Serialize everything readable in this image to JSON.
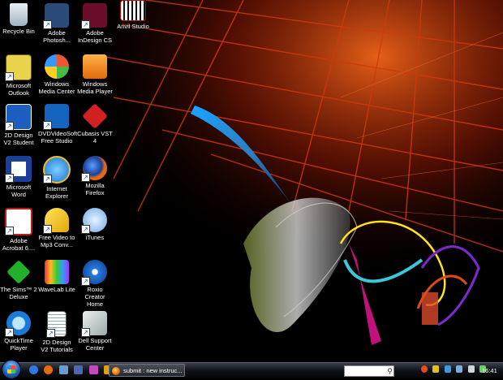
{
  "desktop": {
    "icons": [
      {
        "label": "Recycle Bin",
        "icon": "recycle-bin-icon"
      },
      {
        "label": "Adobe Photosh...",
        "icon": "photoshop-icon"
      },
      {
        "label": "Adobe InDesign CS",
        "icon": "indesign-icon"
      },
      {
        "label": "Anvil Studio",
        "icon": "anvil-studio-icon"
      },
      {
        "label": "Microsoft Outlook",
        "icon": "outlook-icon"
      },
      {
        "label": "Windows Media Center",
        "icon": "media-center-icon"
      },
      {
        "label": "Windows Media Player",
        "icon": "media-player-icon"
      },
      {
        "label": "2D Design V2 Student",
        "icon": "2d-design-icon"
      },
      {
        "label": "DVDVideoSoft Free Studio",
        "icon": "free-studio-icon"
      },
      {
        "label": "Cubasis VST 4",
        "icon": "cubasis-icon"
      },
      {
        "label": "Microsoft Word",
        "icon": "word-icon"
      },
      {
        "label": "Internet Explorer",
        "icon": "internet-explorer-icon"
      },
      {
        "label": "Mozilla Firefox",
        "icon": "firefox-icon"
      },
      {
        "label": "Adobe Acrobat 6....",
        "icon": "acrobat-icon"
      },
      {
        "label": "Free Video to Mp3 Conv...",
        "icon": "video-to-mp3-icon"
      },
      {
        "label": "iTunes",
        "icon": "itunes-icon"
      },
      {
        "label": "The Sims™ 2 Deluxe",
        "icon": "sims-icon"
      },
      {
        "label": "WaveLab Lite",
        "icon": "wavelab-icon"
      },
      {
        "label": "Roxio Creator Home",
        "icon": "roxio-icon"
      },
      {
        "label": "QuickTime Player",
        "icon": "quicktime-icon"
      },
      {
        "label": "2D Design V2 Tutorials",
        "icon": "tutorials-document-icon"
      },
      {
        "label": "Dell Support Center",
        "icon": "dell-support-icon"
      }
    ]
  },
  "taskbar": {
    "task_button": "submit : new instruc...",
    "clock": "16:41",
    "start_icon": "windows-start-orb-icon"
  }
}
